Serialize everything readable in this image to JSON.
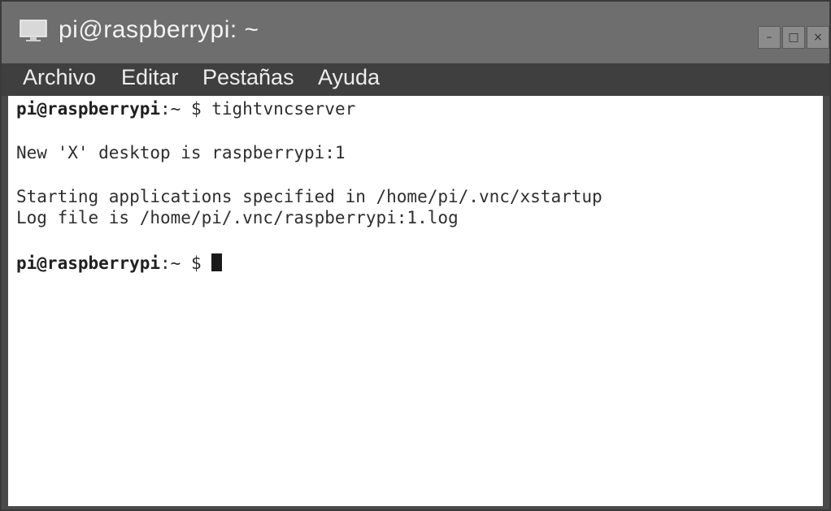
{
  "window": {
    "title": "pi@raspberrypi: ~",
    "buttons": {
      "minimize": "–",
      "maximize": "□",
      "close": "×"
    }
  },
  "menu": {
    "items": [
      "Archivo",
      "Editar",
      "Pestañas",
      "Ayuda"
    ]
  },
  "terminal": {
    "prompt_user": "pi@raspberrypi",
    "prompt_rest": ":~ $ ",
    "lines": [
      {
        "kind": "prompt",
        "command": "tightvncserver"
      },
      {
        "kind": "output",
        "text": "New 'X' desktop is raspberrypi:1"
      },
      {
        "kind": "output",
        "text": "Starting applications specified in /home/pi/.vnc/xstartup"
      },
      {
        "kind": "output",
        "text": "Log file is /home/pi/.vnc/raspberrypi:1.log"
      },
      {
        "kind": "prompt",
        "command": ""
      }
    ]
  },
  "colors": {
    "titlebar": "#6e6e6e",
    "menubar": "#3f3f3f",
    "terminal_bg": "#ffffff",
    "terminal_text": "#2e2e2e"
  }
}
